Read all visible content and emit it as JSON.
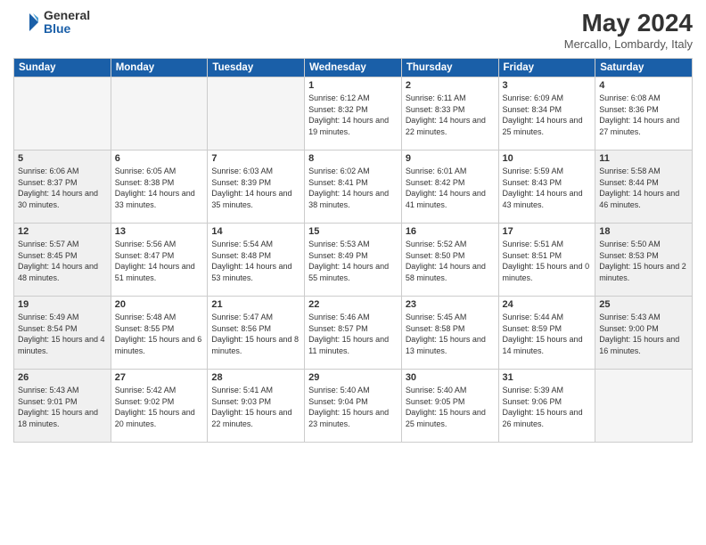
{
  "header": {
    "logo_general": "General",
    "logo_blue": "Blue",
    "month_title": "May 2024",
    "location": "Mercallo, Lombardy, Italy"
  },
  "weekdays": [
    "Sunday",
    "Monday",
    "Tuesday",
    "Wednesday",
    "Thursday",
    "Friday",
    "Saturday"
  ],
  "weeks": [
    [
      {
        "day": "",
        "info": "",
        "empty": true
      },
      {
        "day": "",
        "info": "",
        "empty": true
      },
      {
        "day": "",
        "info": "",
        "empty": true
      },
      {
        "day": "1",
        "info": "Sunrise: 6:12 AM\nSunset: 8:32 PM\nDaylight: 14 hours\nand 19 minutes."
      },
      {
        "day": "2",
        "info": "Sunrise: 6:11 AM\nSunset: 8:33 PM\nDaylight: 14 hours\nand 22 minutes."
      },
      {
        "day": "3",
        "info": "Sunrise: 6:09 AM\nSunset: 8:34 PM\nDaylight: 14 hours\nand 25 minutes."
      },
      {
        "day": "4",
        "info": "Sunrise: 6:08 AM\nSunset: 8:36 PM\nDaylight: 14 hours\nand 27 minutes."
      }
    ],
    [
      {
        "day": "5",
        "info": "Sunrise: 6:06 AM\nSunset: 8:37 PM\nDaylight: 14 hours\nand 30 minutes.",
        "shaded": true
      },
      {
        "day": "6",
        "info": "Sunrise: 6:05 AM\nSunset: 8:38 PM\nDaylight: 14 hours\nand 33 minutes."
      },
      {
        "day": "7",
        "info": "Sunrise: 6:03 AM\nSunset: 8:39 PM\nDaylight: 14 hours\nand 35 minutes."
      },
      {
        "day": "8",
        "info": "Sunrise: 6:02 AM\nSunset: 8:41 PM\nDaylight: 14 hours\nand 38 minutes."
      },
      {
        "day": "9",
        "info": "Sunrise: 6:01 AM\nSunset: 8:42 PM\nDaylight: 14 hours\nand 41 minutes."
      },
      {
        "day": "10",
        "info": "Sunrise: 5:59 AM\nSunset: 8:43 PM\nDaylight: 14 hours\nand 43 minutes."
      },
      {
        "day": "11",
        "info": "Sunrise: 5:58 AM\nSunset: 8:44 PM\nDaylight: 14 hours\nand 46 minutes.",
        "shaded": true
      }
    ],
    [
      {
        "day": "12",
        "info": "Sunrise: 5:57 AM\nSunset: 8:45 PM\nDaylight: 14 hours\nand 48 minutes.",
        "shaded": true
      },
      {
        "day": "13",
        "info": "Sunrise: 5:56 AM\nSunset: 8:47 PM\nDaylight: 14 hours\nand 51 minutes."
      },
      {
        "day": "14",
        "info": "Sunrise: 5:54 AM\nSunset: 8:48 PM\nDaylight: 14 hours\nand 53 minutes."
      },
      {
        "day": "15",
        "info": "Sunrise: 5:53 AM\nSunset: 8:49 PM\nDaylight: 14 hours\nand 55 minutes."
      },
      {
        "day": "16",
        "info": "Sunrise: 5:52 AM\nSunset: 8:50 PM\nDaylight: 14 hours\nand 58 minutes."
      },
      {
        "day": "17",
        "info": "Sunrise: 5:51 AM\nSunset: 8:51 PM\nDaylight: 15 hours\nand 0 minutes."
      },
      {
        "day": "18",
        "info": "Sunrise: 5:50 AM\nSunset: 8:53 PM\nDaylight: 15 hours\nand 2 minutes.",
        "shaded": true
      }
    ],
    [
      {
        "day": "19",
        "info": "Sunrise: 5:49 AM\nSunset: 8:54 PM\nDaylight: 15 hours\nand 4 minutes.",
        "shaded": true
      },
      {
        "day": "20",
        "info": "Sunrise: 5:48 AM\nSunset: 8:55 PM\nDaylight: 15 hours\nand 6 minutes."
      },
      {
        "day": "21",
        "info": "Sunrise: 5:47 AM\nSunset: 8:56 PM\nDaylight: 15 hours\nand 8 minutes."
      },
      {
        "day": "22",
        "info": "Sunrise: 5:46 AM\nSunset: 8:57 PM\nDaylight: 15 hours\nand 11 minutes."
      },
      {
        "day": "23",
        "info": "Sunrise: 5:45 AM\nSunset: 8:58 PM\nDaylight: 15 hours\nand 13 minutes."
      },
      {
        "day": "24",
        "info": "Sunrise: 5:44 AM\nSunset: 8:59 PM\nDaylight: 15 hours\nand 14 minutes."
      },
      {
        "day": "25",
        "info": "Sunrise: 5:43 AM\nSunset: 9:00 PM\nDaylight: 15 hours\nand 16 minutes.",
        "shaded": true
      }
    ],
    [
      {
        "day": "26",
        "info": "Sunrise: 5:43 AM\nSunset: 9:01 PM\nDaylight: 15 hours\nand 18 minutes.",
        "shaded": true
      },
      {
        "day": "27",
        "info": "Sunrise: 5:42 AM\nSunset: 9:02 PM\nDaylight: 15 hours\nand 20 minutes."
      },
      {
        "day": "28",
        "info": "Sunrise: 5:41 AM\nSunset: 9:03 PM\nDaylight: 15 hours\nand 22 minutes."
      },
      {
        "day": "29",
        "info": "Sunrise: 5:40 AM\nSunset: 9:04 PM\nDaylight: 15 hours\nand 23 minutes."
      },
      {
        "day": "30",
        "info": "Sunrise: 5:40 AM\nSunset: 9:05 PM\nDaylight: 15 hours\nand 25 minutes."
      },
      {
        "day": "31",
        "info": "Sunrise: 5:39 AM\nSunset: 9:06 PM\nDaylight: 15 hours\nand 26 minutes."
      },
      {
        "day": "",
        "info": "",
        "empty": true
      }
    ]
  ]
}
